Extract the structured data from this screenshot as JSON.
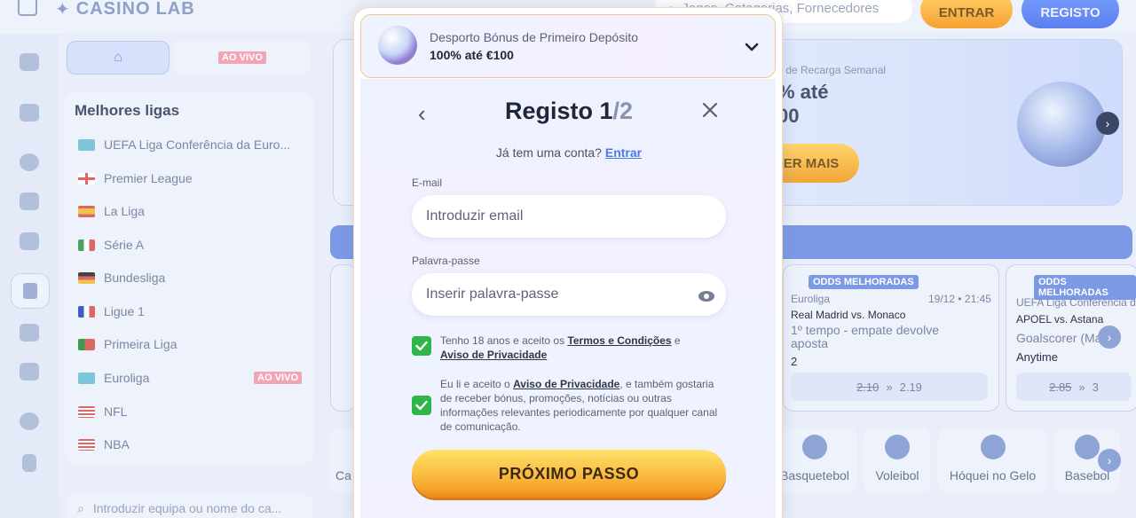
{
  "header": {
    "brand": "CASINOLAB",
    "brand_part1": "CASINO",
    "brand_part2": "LAB",
    "search_placeholder": "Jogos, Categorias, Fornecedores",
    "login_label": "ENTRAR",
    "register_label": "REGISTO"
  },
  "tabs": {
    "live_label": "AO VIVO"
  },
  "sidebar": {
    "title": "Melhores ligas",
    "leagues": [
      {
        "label": "UEFA Liga Conferência da Euro...",
        "flag": "uefa"
      },
      {
        "label": "Premier League",
        "flag": "england"
      },
      {
        "label": "La Liga",
        "flag": "spain"
      },
      {
        "label": "Série A",
        "flag": "italy"
      },
      {
        "label": "Bundesliga",
        "flag": "germany"
      },
      {
        "label": "Ligue 1",
        "flag": "france"
      },
      {
        "label": "Primeira Liga",
        "flag": "portugal"
      },
      {
        "label": "Euroliga",
        "flag": "euroleague",
        "badge": "AO VIVO"
      },
      {
        "label": "NFL",
        "flag": "usa"
      },
      {
        "label": "NBA",
        "flag": "usa"
      }
    ],
    "team_search_placeholder": "Introduzir equipa ou nome do ca..."
  },
  "promo": {
    "subtitle": "s de Recarga Semanal",
    "headline_line1": "% até",
    "headline_line2": "00",
    "button_label": "ER MAIS"
  },
  "cards": [
    {
      "badge": "ODDS MELHORADAS",
      "league": "Euroliga",
      "datetime": "19/12 • 21:45",
      "match": "Real Madrid vs. Monaco",
      "market": "1º tempo - empate devolve aposta",
      "selection": "2",
      "old_odds": "2.10",
      "new_odds": "2.19"
    },
    {
      "badge": "ODDS MELHORADAS",
      "league": "UEFA Liga Conferência d",
      "match": "APOEL vs. Astana",
      "market": "Goalscorer (Ma...",
      "selection": "Anytime",
      "old_odds": "2.85",
      "new_odds": "3"
    }
  ],
  "sports": [
    "Ca",
    "Basquetebol",
    "Voleibol",
    "Hóquei no Gelo",
    "Basebol"
  ],
  "modal": {
    "bonus_title": "Desporto Bónus de Primeiro Depósito",
    "bonus_value": "100% até €100",
    "title_main": "Registo 1",
    "title_slash": "/2",
    "have_account": "Já tem uma conta?",
    "login_link": "Entrar",
    "email_label": "E-mail",
    "email_placeholder": "Introduzir email",
    "password_label": "Palavra-passe",
    "password_placeholder": "Inserir palavra-passe",
    "terms_pre": "Tenho 18 anos e aceito os ",
    "terms_link": "Termos e Condições",
    "terms_mid": " e",
    "privacy_link": "Aviso de Privacidade",
    "marketing_pre": "Eu li e aceito o ",
    "marketing_link": "Aviso de Privacidade",
    "marketing_post": ", e também gostaria de receber bónus, promoções, notícias ou outras informações relevantes periodicamente por qualquer canal de comunicação.",
    "next_label": "PRÓXIMO PASSO"
  },
  "colors": {
    "accent_blue": "#4a7be8",
    "checkbox_green": "#2fb54a",
    "cta_orange": "#f7a62c"
  }
}
